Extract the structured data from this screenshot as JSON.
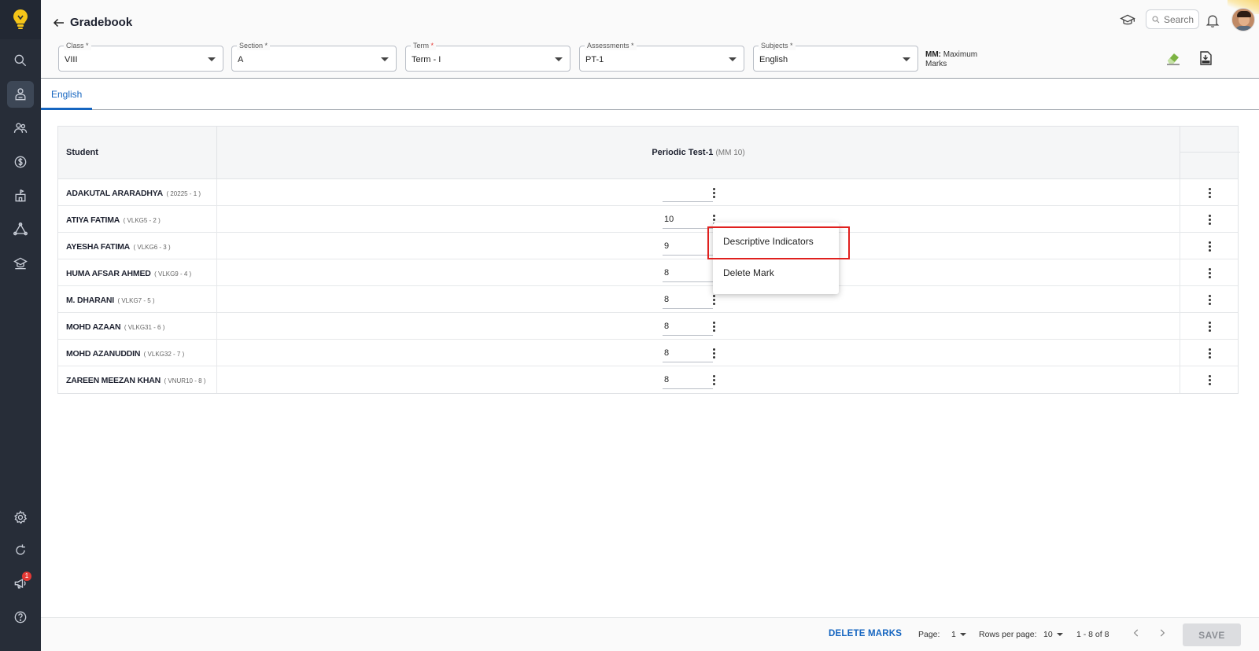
{
  "header": {
    "title": "Gradebook",
    "search_placeholder": "Search"
  },
  "filters": [
    {
      "label": "Class",
      "required_mark": "*",
      "value": "VIII"
    },
    {
      "label": "Section",
      "required_mark": "*",
      "value": "A"
    },
    {
      "label": "Term",
      "required_mark": "*",
      "value": "Term - I"
    },
    {
      "label": "Assessments",
      "required_mark": "*",
      "value": "PT-1"
    },
    {
      "label": "Subjects",
      "required_mark": "*",
      "value": "English"
    }
  ],
  "mm_note": {
    "prefix": "MM:",
    "text": "Maximum Marks"
  },
  "tabs": [
    {
      "label": "English",
      "active": true
    }
  ],
  "table": {
    "student_header": "Student",
    "test_header": "Periodic Test-1",
    "test_max": "(MM 10)",
    "rows": [
      {
        "name": "ADAKUTAL ARARADHYA",
        "id": "( 20225 - 1 )",
        "mark": ""
      },
      {
        "name": "ATIYA FATIMA",
        "id": "( VLKG5 - 2 )",
        "mark": "10"
      },
      {
        "name": "AYESHA FATIMA",
        "id": "( VLKG6 - 3 )",
        "mark": "9"
      },
      {
        "name": "HUMA AFSAR AHMED",
        "id": "( VLKG9 - 4 )",
        "mark": "8"
      },
      {
        "name": "M. DHARANI",
        "id": "( VLKG7 - 5 )",
        "mark": "8"
      },
      {
        "name": "MOHD AZAAN",
        "id": "( VLKG31 - 6 )",
        "mark": "8"
      },
      {
        "name": "MOHD AZANUDDIN",
        "id": "( VLKG32 - 7 )",
        "mark": "8"
      },
      {
        "name": "ZAREEN MEEZAN KHAN",
        "id": "( VNUR10 - 8 )",
        "mark": "8"
      }
    ]
  },
  "context_menu": {
    "items": [
      "Descriptive Indicators",
      "Delete Mark"
    ]
  },
  "footer": {
    "delete_marks": "DELETE MARKS",
    "page_label": "Page:",
    "page_value": "1",
    "rows_label": "Rows per page:",
    "rows_value": "10",
    "range": "1 - 8 of 8",
    "save": "SAVE"
  },
  "notifications_badge": "1",
  "colors": {
    "accent": "#1565c0",
    "sidebar": "#272d38",
    "highlight": "#e0201e"
  },
  "icons": {
    "sidebar": [
      "search-icon",
      "gradebook-icon",
      "people-icon",
      "fees-icon",
      "school-icon",
      "network-icon",
      "academics-icon",
      "settings-icon",
      "refresh-icon",
      "announcement-icon",
      "help-icon"
    ],
    "header": [
      "back-arrow-icon",
      "graduation-cap-icon",
      "search-icon",
      "bell-icon",
      "eraser-icon",
      "export-xls-icon"
    ]
  }
}
